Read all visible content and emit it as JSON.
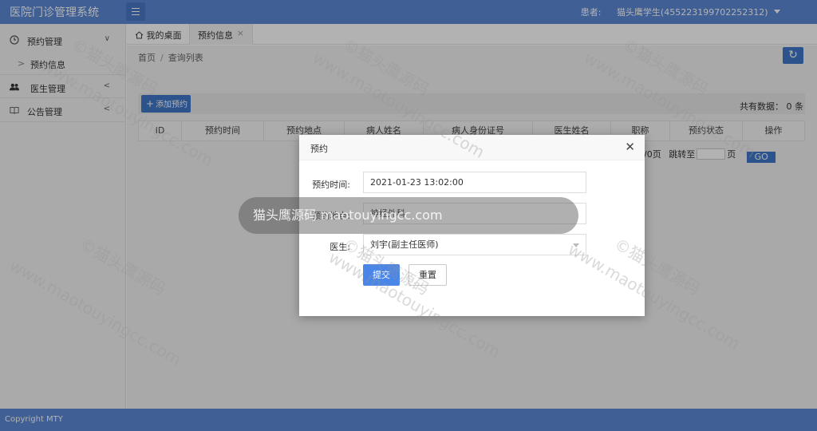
{
  "app": {
    "title": "医院门诊管理系统"
  },
  "header": {
    "role_label": "患者:",
    "user_name": "猫头鹰学生(455223199702252312)"
  },
  "sidebar": {
    "items": [
      {
        "label": "预约管理",
        "icon": "clock-icon"
      },
      {
        "label": "预约信息",
        "sub": true
      },
      {
        "label": "医生管理",
        "icon": "users-icon"
      },
      {
        "label": "公告管理",
        "icon": "book-icon"
      }
    ]
  },
  "tabs": [
    {
      "label": "我的桌面"
    },
    {
      "label": "预约信息"
    }
  ],
  "breadcrumb": {
    "home": "首页",
    "sep": "/",
    "current": "查询列表"
  },
  "toolbar": {
    "add_label": "添加预约",
    "total_text": "共有数据： 0 条"
  },
  "table": {
    "columns": [
      "ID",
      "预约时间",
      "预约地点",
      "病人姓名",
      "病人身份证号",
      "医生姓名",
      "职称",
      "预约状态",
      "操作"
    ]
  },
  "pager": {
    "page_suffix": "/0页",
    "jump_label": "跳转至",
    "page_unit": "页",
    "go_label": "GO"
  },
  "footer": {
    "copyright": "Copyright MTY"
  },
  "modal": {
    "title": "预约",
    "time_label": "预约时间:",
    "time_value": "2021-01-23 13:02:00",
    "place_label": "预约地点:",
    "place_value": "神经外科",
    "doctor_label": "医生:",
    "doctor_value": "刘宇(副主任医师)",
    "submit_label": "提交",
    "reset_label": "重置"
  },
  "watermark": {
    "toast": "猫头鹰源码 maotouyingcc.com",
    "text": "www.maotouyingcc.com",
    "text_cn": "©猫头鹰源码"
  },
  "colors": {
    "header": "#5b88d6",
    "primary": "#3f77c9",
    "submit": "#4a86e8"
  }
}
